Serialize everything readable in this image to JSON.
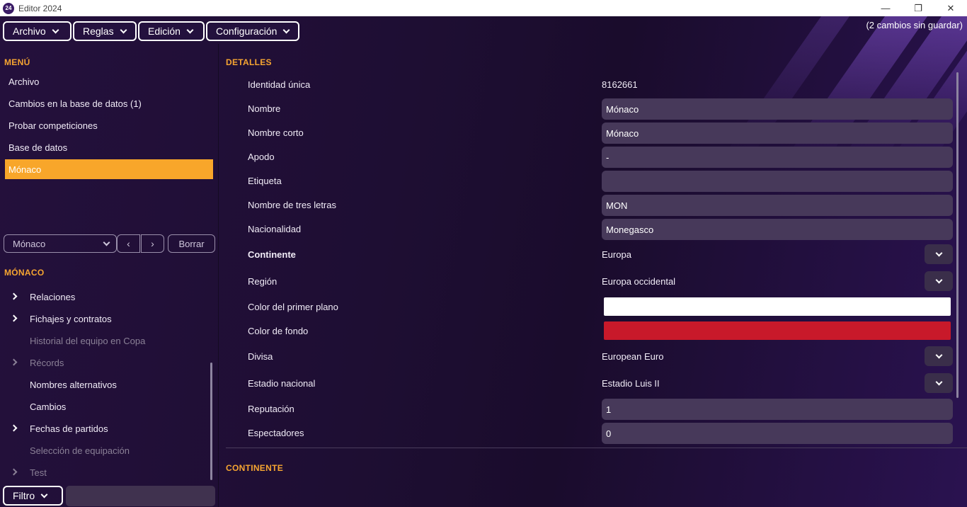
{
  "window": {
    "title": "Editor 2024",
    "logo_text": "24",
    "controls": {
      "minimize": "—",
      "restore": "❐",
      "close": "✕"
    }
  },
  "menubar": {
    "items": [
      "Archivo",
      "Reglas",
      "Edición",
      "Configuración"
    ],
    "unsaved": "(2 cambios sin guardar)"
  },
  "sidebar": {
    "menu_title": "MENÚ",
    "items": [
      "Archivo",
      "Cambios en la base de datos (1)",
      "Probar competiciones",
      "Base de datos"
    ],
    "active_item": "Mónaco",
    "selector_value": "Mónaco",
    "prev": "‹",
    "next": "›",
    "clear_label": "Borrar",
    "entity_title": "MÓNACO",
    "tree": [
      {
        "label": "Relaciones",
        "expandable": true,
        "dim": false
      },
      {
        "label": "Fichajes y contratos",
        "expandable": true,
        "dim": false
      },
      {
        "label": "Historial del equipo en Copa",
        "expandable": false,
        "dim": true
      },
      {
        "label": "Récords",
        "expandable": true,
        "dim": true
      },
      {
        "label": "Nombres alternativos",
        "expandable": false,
        "dim": false
      },
      {
        "label": "Cambios",
        "expandable": false,
        "dim": false
      },
      {
        "label": "Fechas de partidos",
        "expandable": true,
        "dim": false
      },
      {
        "label": "Selección de equipación",
        "expandable": false,
        "dim": true
      },
      {
        "label": "Test",
        "expandable": true,
        "dim": true
      }
    ],
    "filter_label": "Filtro",
    "filter_value": ""
  },
  "details": {
    "title": "DETALLES",
    "rows": [
      {
        "label": "Identidad única",
        "value": "8162661",
        "kind": "text"
      },
      {
        "label": "Nombre",
        "value": "Mónaco",
        "kind": "input"
      },
      {
        "label": "Nombre corto",
        "value": "Mónaco",
        "kind": "input"
      },
      {
        "label": "Apodo",
        "value": "-",
        "kind": "input"
      },
      {
        "label": "Etiqueta",
        "value": "",
        "kind": "input"
      },
      {
        "label": "Nombre de tres letras",
        "value": "MON",
        "kind": "input"
      },
      {
        "label": "Nacionalidad",
        "value": "Monegasco",
        "kind": "input"
      },
      {
        "label": "Continente",
        "value": "Europa",
        "kind": "select",
        "bold": true
      },
      {
        "label": "Región",
        "value": "Europa occidental",
        "kind": "select"
      },
      {
        "label": "Color del primer plano",
        "value": "#ffffff",
        "kind": "color"
      },
      {
        "label": "Color de fondo",
        "value": "#c8192a",
        "kind": "color"
      },
      {
        "label": "Divisa",
        "value": "European Euro",
        "kind": "select"
      },
      {
        "label": "Estadio nacional",
        "value": "Estadio Luis II",
        "kind": "select"
      },
      {
        "label": "Reputación",
        "value": "1",
        "kind": "input"
      },
      {
        "label": "Espectadores",
        "value": "0",
        "kind": "input"
      }
    ],
    "continent_section_title": "CONTINENTE"
  },
  "colors": {
    "accent": "#f8a62a",
    "background": "#1d0f2e",
    "field": "#47395a"
  }
}
